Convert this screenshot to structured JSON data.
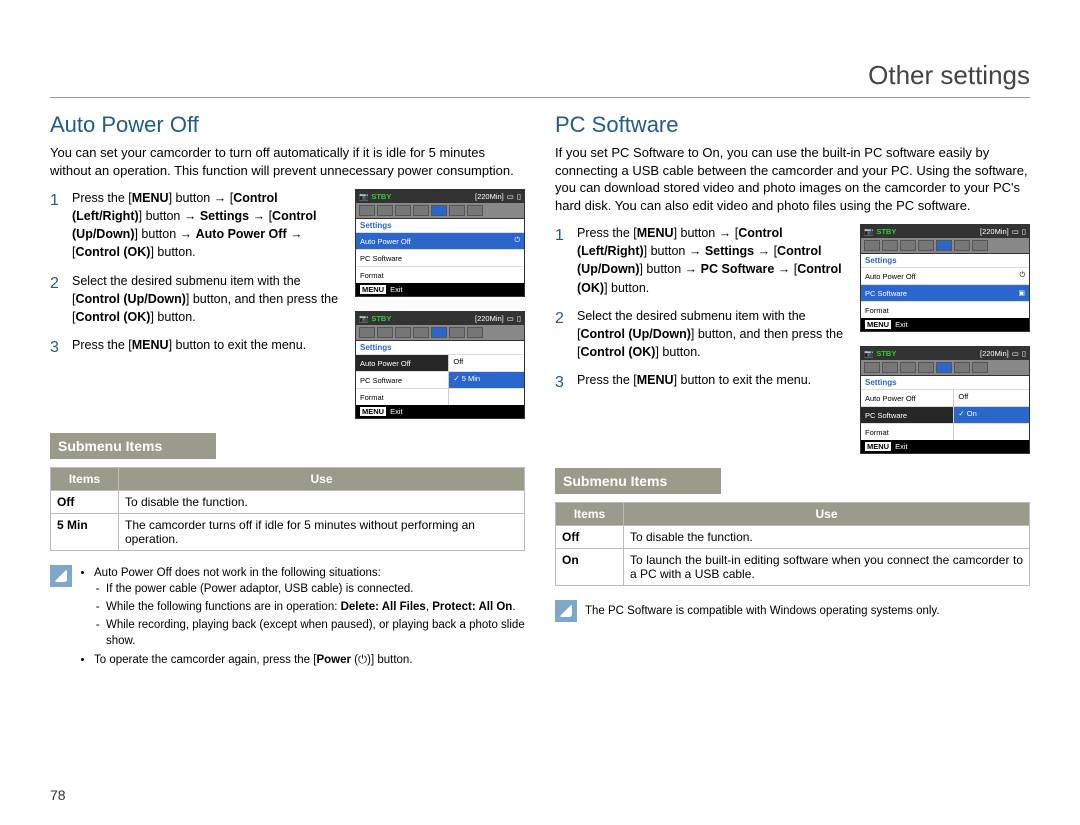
{
  "pageHeader": "Other settings",
  "pageNumber": "78",
  "left": {
    "title": "Auto Power Off",
    "intro": "You can set your camcorder to turn off automatically if it is idle for 5 minutes without an operation. This function will prevent unnecessary power consumption.",
    "step1_a": "Press the [",
    "step1_b": "MENU",
    "step1_c": "] button → [",
    "step1_d": "Control (Left/Right)",
    "step1_e": "] button → ",
    "step1_f": "Settings",
    "step1_g": " → [",
    "step1_h": "Control (Up/Down)",
    "step1_i": "] button → ",
    "step1_j": "Auto Power Off",
    "step1_k": " → [",
    "step1_l": "Control (OK)",
    "step1_m": "] button.",
    "step2_a": "Select the desired submenu item with the [",
    "step2_b": "Control (Up/Down)",
    "step2_c": "] button, and then press the [",
    "step2_d": "Control (OK)",
    "step2_e": "] button.",
    "step3_a": "Press the [",
    "step3_b": "MENU",
    "step3_c": "] button to exit the menu.",
    "submenuTitle": "Submenu Items",
    "th1": "Items",
    "th2": "Use",
    "r1c1": "Off",
    "r1c2": "To disable the function.",
    "r2c1": "5 Min",
    "r2c2": "The camcorder turns off if idle for 5 minutes without performing an operation.",
    "note_b1": "Auto Power Off does not work in the following situations:",
    "note_s1": "If the power cable (Power adaptor, USB cable) is connected.",
    "note_s2a": "While the following functions are in operation: ",
    "note_s2b": "Delete: All Files",
    "note_s2c": ", ",
    "note_s2d": "Protect: All On",
    "note_s2e": ".",
    "note_s3": "While recording, playing back (except when paused), or playing back a photo slide show.",
    "note_b2a": "To operate the camcorder again, press the [",
    "note_b2b": "Power",
    "note_b2c": " (",
    "note_b2d": ")] button.",
    "sc": {
      "stby": "STBY",
      "time": "[220Min]",
      "settings": "Settings",
      "apo": "Auto Power Off",
      "pcs": "PC Software",
      "format": "Format",
      "menu": "MENU",
      "exit": "Exit",
      "off": "Off",
      "fivemin": "5 Min"
    }
  },
  "right": {
    "title": "PC Software",
    "intro": "If you set PC Software to On, you can use the built-in PC software easily by connecting a USB cable between the camcorder and your PC. Using the software, you can download stored video and photo images on the camcorder to your PC's hard disk. You can also edit video and photo files using the PC software.",
    "step1_a": "Press the [",
    "step1_b": "MENU",
    "step1_c": "] button → [",
    "step1_d": "Control (Left/Right)",
    "step1_e": "] button → ",
    "step1_f": "Settings",
    "step1_g": " → [",
    "step1_h": "Control (Up/Down)",
    "step1_i": "] button → ",
    "step1_j": "PC Software",
    "step1_k": " → [",
    "step1_l": "Control (OK)",
    "step1_m": "] button.",
    "step2_a": "Select the desired submenu item with the [",
    "step2_b": "Control (Up/Down)",
    "step2_c": "] button, and then press the [",
    "step2_d": "Control (OK)",
    "step2_e": "] button.",
    "step3_a": "Press the [",
    "step3_b": "MENU",
    "step3_c": "] button to exit the menu.",
    "submenuTitle": "Submenu Items",
    "th1": "Items",
    "th2": "Use",
    "r1c1": "Off",
    "r1c2": "To disable the function.",
    "r2c1": "On",
    "r2c2": "To launch the built-in editing software when you connect the camcorder to a PC with a USB cable.",
    "note": "The PC Software is compatible with Windows operating systems only.",
    "sc": {
      "stby": "STBY",
      "time": "[220Min]",
      "settings": "Settings",
      "apo": "Auto Power Off",
      "pcs": "PC Software",
      "format": "Format",
      "menu": "MENU",
      "exit": "Exit",
      "off": "Off",
      "on": "On"
    }
  }
}
